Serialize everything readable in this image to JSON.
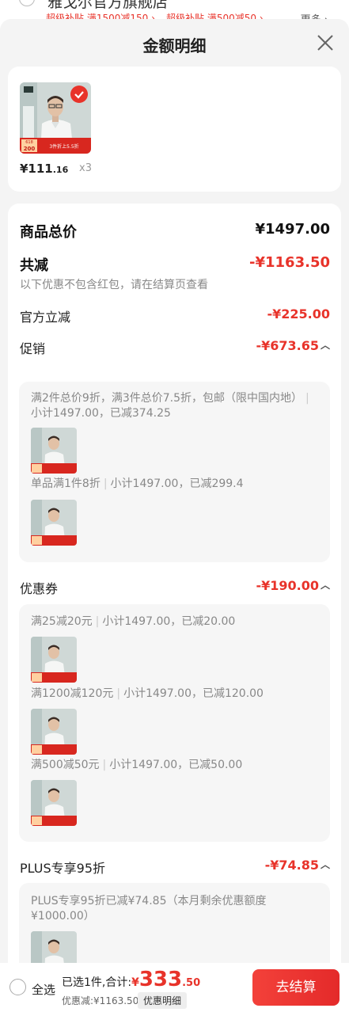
{
  "background": {
    "store_name": "雅戈尔官方旗舰店",
    "promo_1": "超级补贴 满1500减150 ›",
    "promo_2": "超级补贴 满500减50 ›",
    "more": "更多 ›"
  },
  "sheet": {
    "title": "金额明细"
  },
  "product": {
    "price_int": "¥111",
    "price_dec": ".16",
    "qty": "x3",
    "thumb_badge_top": "618",
    "thumb_badge_price": "200",
    "thumb_promo": "3件折上5.5折"
  },
  "detail": {
    "total_label": "商品总价",
    "total_value": "¥1497.00",
    "reduce_label": "共减",
    "reduce_value": "-¥1163.50",
    "reduce_note": "以下优惠不包含红包，请在结算页查看",
    "official_label": "官方立减",
    "official_value": "-¥225.00",
    "promo_label": "促销",
    "promo_value": "-¥673.65",
    "promo_items": [
      {
        "title": "满2件总价9折，满3件总价7.5折，包邮（限中国内地）",
        "subtotal": "小计1497.00，已减374.25"
      },
      {
        "title": "单品满1件8折",
        "subtotal": "小计1497.00，已减299.4"
      }
    ],
    "coupon_label": "优惠券",
    "coupon_value": "-¥190.00",
    "coupon_items": [
      {
        "title": "满25减20元",
        "subtotal": "小计1497.00，已减20.00"
      },
      {
        "title": "满1200减120元",
        "subtotal": "小计1497.00，已减120.00"
      },
      {
        "title": "满500减50元",
        "subtotal": "小计1497.00，已减50.00"
      }
    ],
    "plus_label": "PLUS专享95折",
    "plus_value": "-¥74.85",
    "plus_text": "PLUS专享95折已减¥74.85（本月剩余优惠额度¥1000.00）"
  },
  "bottom": {
    "select_all": "全选",
    "selected_sum_label": "已选1件,合计:",
    "currency": "¥",
    "total_int": "333",
    "total_dec": ".50",
    "discount_text": "优惠减:¥1163.50",
    "detail_button": "优惠明细",
    "checkout_button": "去结算"
  },
  "colors": {
    "accent_red": "#e8332a",
    "checkout_gradient_start": "#f3413a",
    "checkout_gradient_end": "#e42a2a"
  }
}
